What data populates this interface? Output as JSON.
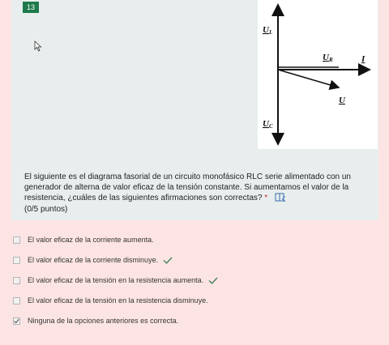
{
  "question": {
    "number": "13",
    "text": "El siguiente es el diagrama fasorial de un circuito monofásico RLC serie alimentado con un generador de alterna de valor eficaz de la tensión constante. Si aumentamos el valor de la resistencia, ¿cuáles de las siguientes afirmaciones son correctas?",
    "required_mark": "*",
    "points": "(0/5 puntos)"
  },
  "diagram": {
    "label_UL_main": "U",
    "label_UL_sub": "L",
    "label_UR_main": "U",
    "label_UR_sub": "R",
    "label_I": "I",
    "label_U": "U",
    "label_UC_main": "U",
    "label_UC_sub": "C"
  },
  "options": [
    {
      "label": "El valor eficaz de la corriente aumenta.",
      "checked": false,
      "marked_correct": false
    },
    {
      "label": "El valor eficaz de la corriente disminuye.",
      "checked": false,
      "marked_correct": true
    },
    {
      "label": "El valor eficaz de la tensión en la resistencia aumenta.",
      "checked": false,
      "marked_correct": true
    },
    {
      "label": "El valor eficaz de la tensión en la resistencia disminuye.",
      "checked": false,
      "marked_correct": false
    },
    {
      "label": "Ninguna de la opciones anteriores es correcta.",
      "checked": true,
      "marked_correct": false
    }
  ],
  "icons": {
    "cursor": "mouse-pointer-icon",
    "immersive_reader": "immersive-reader-icon",
    "correct_check": "checkmark-icon"
  }
}
